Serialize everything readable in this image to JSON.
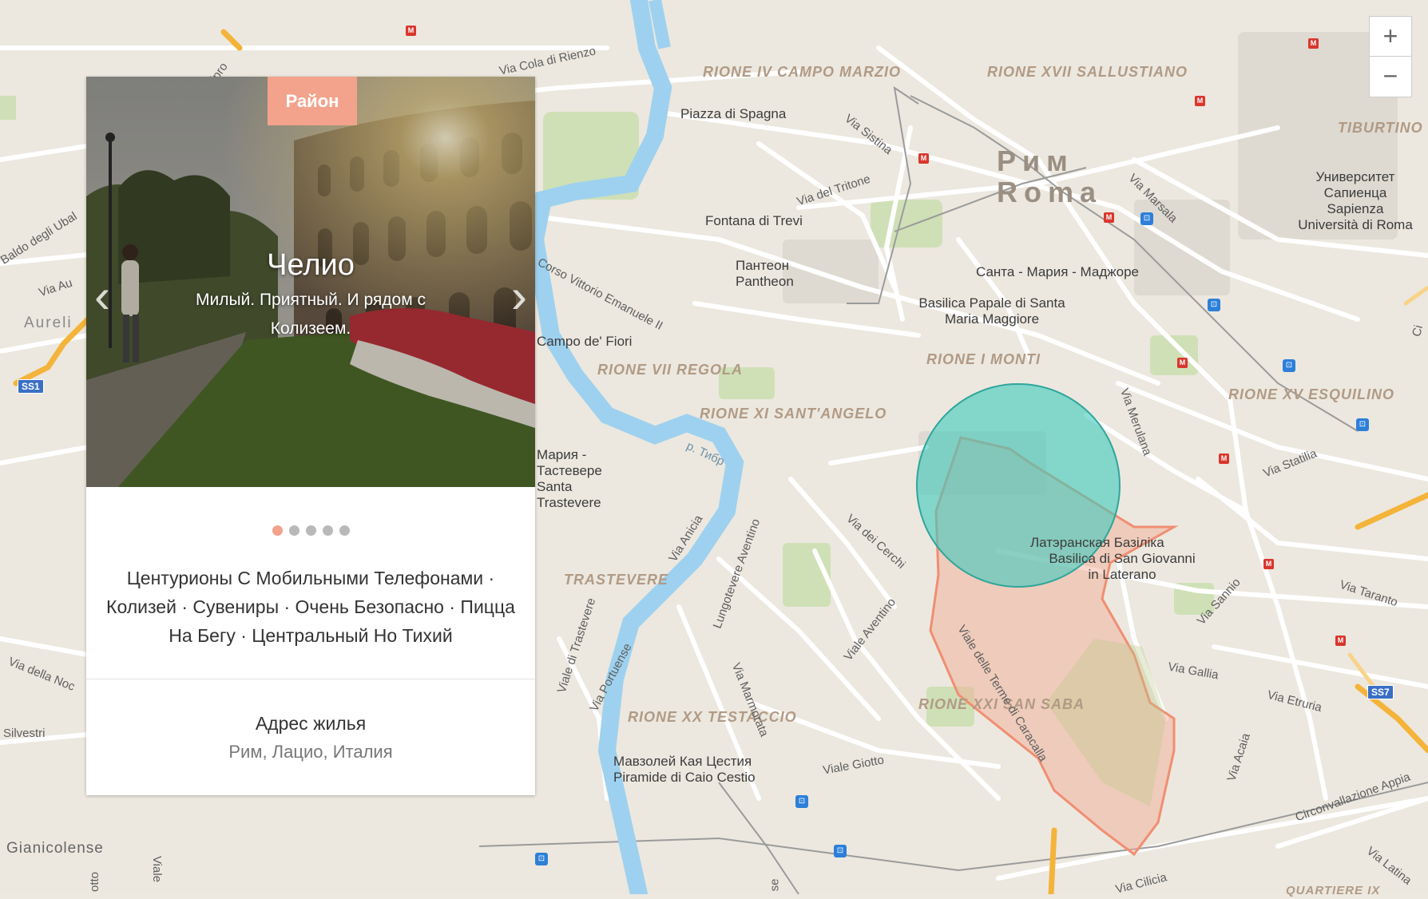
{
  "map": {
    "districts": [
      "RIONE IV CAMPO MARZIO",
      "RIONE XVII SALLUSTIANO",
      "TIBURTINO",
      "RIONE VII REGOLA",
      "RIONE XI SANT'ANGELO",
      "RIONE I MONTI",
      "RIONE XV ESQUILINO",
      "TRASTEVERE",
      "RIONE XX TESTACCIO",
      "RIONE XXI SAN SABA"
    ],
    "city_ru": "Рим",
    "city_it": "Roma",
    "pois": {
      "spagna": "Piazza di Spagna",
      "trevi": "Fontana di Trevi",
      "pantheon_ru": "Пантеон",
      "pantheon_it": "Pantheon",
      "smm_ru": "Санта - Мария - Маджоре",
      "smm_it": "Basilica Papale di Santa Maria Maggiore",
      "campo": "Campo de' Fiori",
      "trastevere_church": "Мария - Тастевере Santa Trastevere",
      "lateran_ru": "Латэранская Базіліка",
      "lateran_it": "Basilica di San Giovanni in Laterano",
      "cestius_ru": "Мавзолей Кая Цестия",
      "cestius_it": "Piramide di Caio Cestio",
      "university": "Университет Сапиенца Sapienza Università di Roma",
      "tiber": "р. Тибр"
    },
    "streets": {
      "cola": "Via Cola di Rienzo",
      "sistina": "Via Sistina",
      "tritone": "Via del Tritone",
      "marsala": "Via Marsala",
      "corso": "Corso Vittorio Emanuele II",
      "merulana": "Via Merulana",
      "statilia": "Via Statilia",
      "cerchi": "Via dei Cerchi",
      "anicia": "Via Anicia",
      "lungotevere": "Lungotevere Aventino",
      "aventino": "Viale Aventino",
      "terme": "Viale delle Terme di Caracalla",
      "taranto": "Via Taranto",
      "sannio": "Via Sannio",
      "gallia": "Via Gallia",
      "etruria": "Via Etruria",
      "acaia": "Via Acaia",
      "appia": "Circonvallazione Appia",
      "latina": "Via Latina",
      "cilicia": "Via Cilicia",
      "giotto": "Viale Giotto",
      "marmorata": "Via Marmorata",
      "portuense": "Via Portuense",
      "trastevere_viale": "Viale di Trastevere",
      "gianicolense": "Gianicolense",
      "silvestri": "Silvestri",
      "nocetta": "Via della Noc",
      "aurelia": "Aureli",
      "aurelia_via": "Via Au",
      "baldo": "Baldo degli Ubal",
      "ripro": "ipro",
      "viale_bottom": "Viale",
      "otto": "otto",
      "quartiere": "QUARTIERE IX",
      "ci": "Ci",
      "se": "se"
    },
    "shields": [
      "SS1",
      "SS7"
    ],
    "zoom_in": "+",
    "zoom_out": "−",
    "colors": {
      "circle": "#3ec9bd",
      "polygon": "#f4a890"
    }
  },
  "card": {
    "badge": "Район",
    "title": "Челио",
    "subtitle": "Милый. Приятный. И рядом с Колизеем.",
    "tags": "Центурионы С Мобильными Телефонами · Колизей · Сувениры · Очень Безопасно · Пицца На Бегу · Центральный Но Тихий",
    "address_label": "Адрес жилья",
    "address_value": "Рим, Лацио, Италия",
    "slide_count": 5,
    "active_slide": 1
  }
}
